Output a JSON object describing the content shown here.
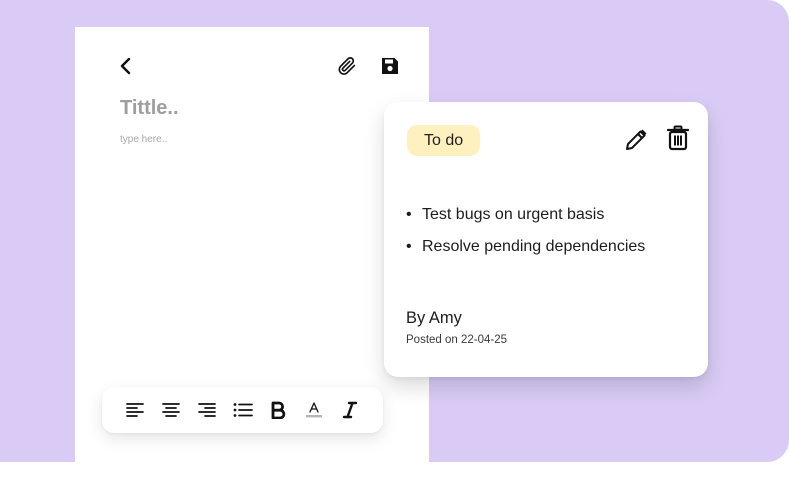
{
  "editor": {
    "title_placeholder": "Tittle..",
    "body_placeholder": "type here.."
  },
  "note": {
    "tag": "To do",
    "items": [
      {
        "bullet": "•",
        "text": "Test bugs on urgent basis"
      },
      {
        "bullet": "•",
        "text": "Resolve pending dependencies"
      }
    ],
    "author": "By Amy",
    "posted": "Posted on 22-04-25"
  },
  "icons": {
    "back": "chevron-left-icon",
    "attach": "paperclip-icon",
    "save": "floppy-disk-icon",
    "edit": "pencil-icon",
    "delete": "trash-icon",
    "toolbar": [
      "align-left-icon",
      "align-center-icon",
      "align-right-icon",
      "list-icon",
      "bold-icon",
      "text-color-icon",
      "italic-icon"
    ]
  },
  "colors": {
    "background": "#d9cbf5",
    "tag_bg": "#fff1bf"
  }
}
